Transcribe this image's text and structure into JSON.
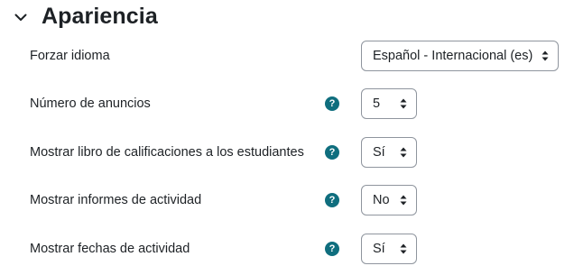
{
  "section": {
    "title": "Apariencia",
    "toggle_icon": "chevron-down-icon"
  },
  "settings": [
    {
      "label": "Forzar idioma",
      "value": "Español - Internacional (es)",
      "has_help": false
    },
    {
      "label": "Número de anuncios",
      "value": "5",
      "has_help": true
    },
    {
      "label": "Mostrar libro de calificaciones a los estudiantes",
      "value": "Sí",
      "has_help": true
    },
    {
      "label": "Mostrar informes de actividad",
      "value": "No",
      "has_help": true
    },
    {
      "label": "Mostrar fechas de actividad",
      "value": "Sí",
      "has_help": true
    }
  ],
  "help_icon_glyph": "?",
  "colors": {
    "help_icon": "#0f6e7e",
    "border": "#8f959e",
    "text": "#1d2125"
  }
}
